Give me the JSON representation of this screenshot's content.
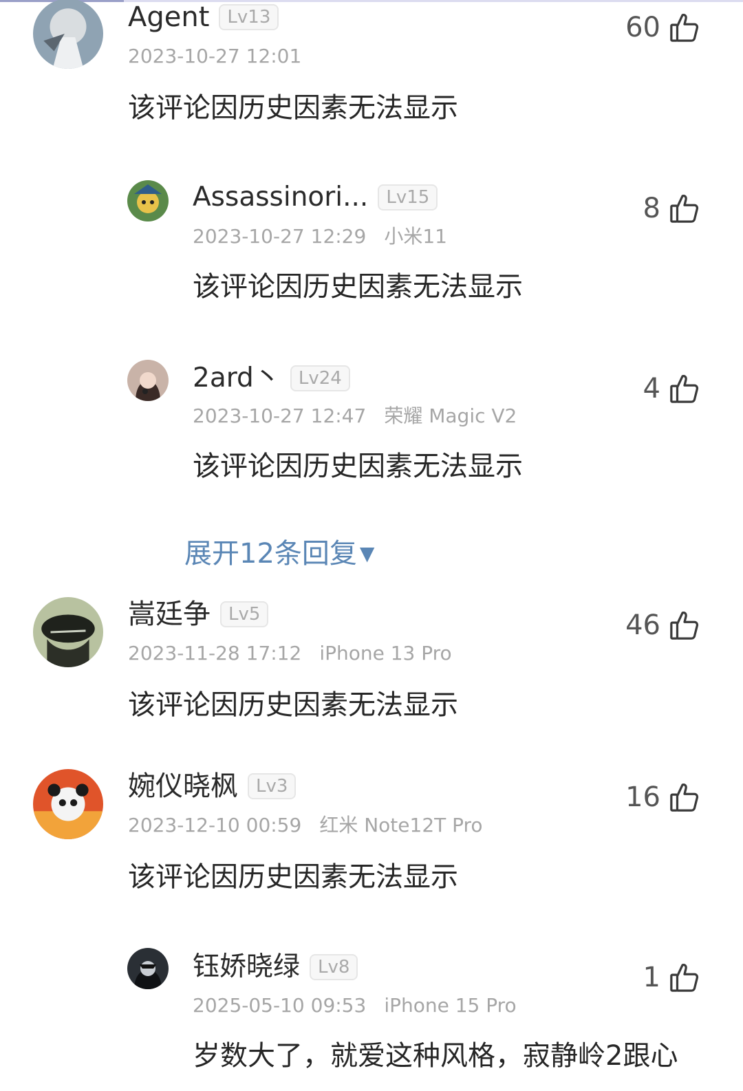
{
  "comments": [
    {
      "username": "Agent",
      "level": "Lv13",
      "time": "2023-10-27 12:01",
      "device": "",
      "text": "该评论因历史因素无法显示",
      "likes": "60"
    },
    {
      "username": "Assassinori...",
      "level": "Lv15",
      "time": "2023-10-27 12:29",
      "device": "小米11",
      "text": "该评论因历史因素无法显示",
      "likes": "8"
    },
    {
      "username": "2ard丶",
      "level": "Lv24",
      "time": "2023-10-27 12:47",
      "device": "荣耀 Magic V2",
      "text": "该评论因历史因素无法显示",
      "likes": "4"
    },
    {
      "username": "嵩廷争",
      "level": "Lv5",
      "time": "2023-11-28 17:12",
      "device": "iPhone 13 Pro",
      "text": "该评论因历史因素无法显示",
      "likes": "46"
    },
    {
      "username": "婉仪晓枫",
      "level": "Lv3",
      "time": "2023-12-10 00:59",
      "device": "红米 Note12T Pro",
      "text": "该评论因历史因素无法显示",
      "likes": "16"
    },
    {
      "username": "钰娇晓绿",
      "level": "Lv8",
      "time": "2025-05-10 09:53",
      "device": "iPhone 15 Pro",
      "text": "岁数大了，就爱这种风格，寂静岭2跟心",
      "likes": "1"
    }
  ],
  "expand_replies": {
    "label": "展开12条回复",
    "icon": "triangle-down-icon",
    "color": "#5a86b5"
  },
  "icons": {
    "like": "thumbs-up-icon"
  }
}
